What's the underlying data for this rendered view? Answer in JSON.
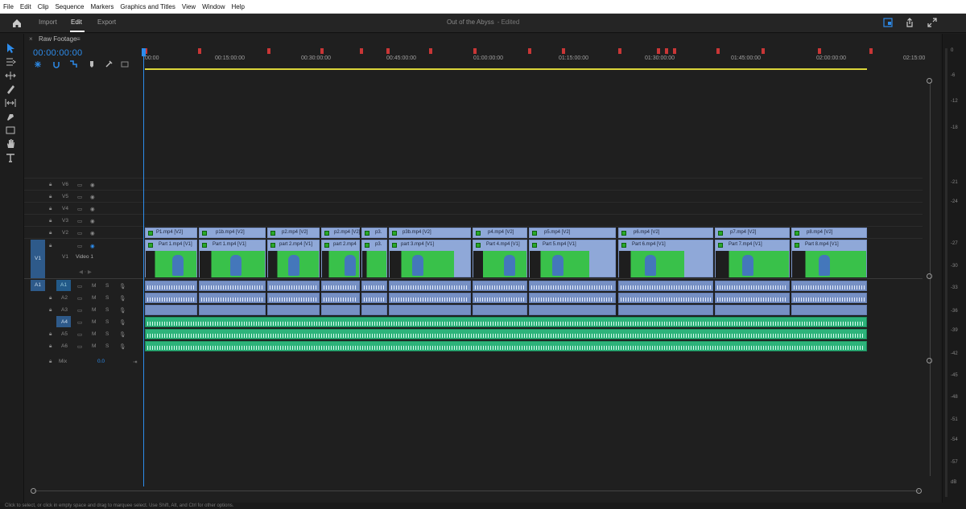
{
  "menubar": {
    "items": [
      "File",
      "Edit",
      "Clip",
      "Sequence",
      "Markers",
      "Graphics and Titles",
      "View",
      "Window",
      "Help"
    ]
  },
  "topbar": {
    "tabs": [
      {
        "label": "Import",
        "active": false
      },
      {
        "label": "Edit",
        "active": true
      },
      {
        "label": "Export",
        "active": false
      }
    ],
    "doc_title": "Out of the Abyss",
    "doc_status": "- Edited"
  },
  "sequence_panel": {
    "tab_name": "Raw Footage",
    "timecode": "00:00:00:00",
    "ruler_ticks": [
      ":00:00",
      "00:15:00:00",
      "00:30:00:00",
      "00:45:00:00",
      "01:00:00:00",
      "01:15:00:00",
      "01:30:00:00",
      "01:45:00:00",
      "02:00:00:00",
      "02:15:00"
    ],
    "video_tracks": [
      {
        "name": "V6"
      },
      {
        "name": "V5"
      },
      {
        "name": "V4"
      },
      {
        "name": "V3"
      },
      {
        "name": "V2"
      },
      {
        "name": "V1",
        "label": "Video 1",
        "source": "V1"
      }
    ],
    "audio_tracks": [
      {
        "name": "A1",
        "source": "A1"
      },
      {
        "name": "A2"
      },
      {
        "name": "A3"
      },
      {
        "name": "A4"
      },
      {
        "name": "A5"
      },
      {
        "name": "A6"
      }
    ],
    "mix": {
      "label": "Mix",
      "value": "0.0"
    },
    "v2_clips": [
      "P1.mp4 [V2]",
      "p1b.mp4 [V2]",
      "p2.mp4 [V2]",
      "p2.mp4 [V2]",
      "p3.",
      "p3b.mp4 [V2]",
      "p4.mp4 [V2]",
      "p5.mp4 [V2]",
      "p6.mp4 [V2]",
      "p7.mp4 [V2]",
      "p8.mp4 [V2]"
    ],
    "v1_clips": [
      "Part 1.mp4 [V1]",
      "Part 1.mp4 [V1]",
      "part 2.mp4 [V1]",
      "part 2.mp4",
      "p3.",
      "part 3.mp4 [V1]",
      "Part 4.mp4 [V1]",
      "Part 5.mp4 [V1]",
      "Part 6.mp4 [V1]",
      "Part 7.mp4 [V1]",
      "Part 8.mp4 [V1]"
    ],
    "track_buttons": {
      "m": "M",
      "s": "S"
    }
  },
  "vu_meter": {
    "labels": [
      "0",
      "-6",
      "-12",
      "-18",
      "-21",
      "-24",
      "-27",
      "-30",
      "-33",
      "-36",
      "-39",
      "-42",
      "-45",
      "-48",
      "-51",
      "-54",
      "-57",
      "dB"
    ]
  },
  "status_bar": "Click to select, or click in empty space and drag to marquee select. Use Shift, Alt, and Ctrl for other options."
}
